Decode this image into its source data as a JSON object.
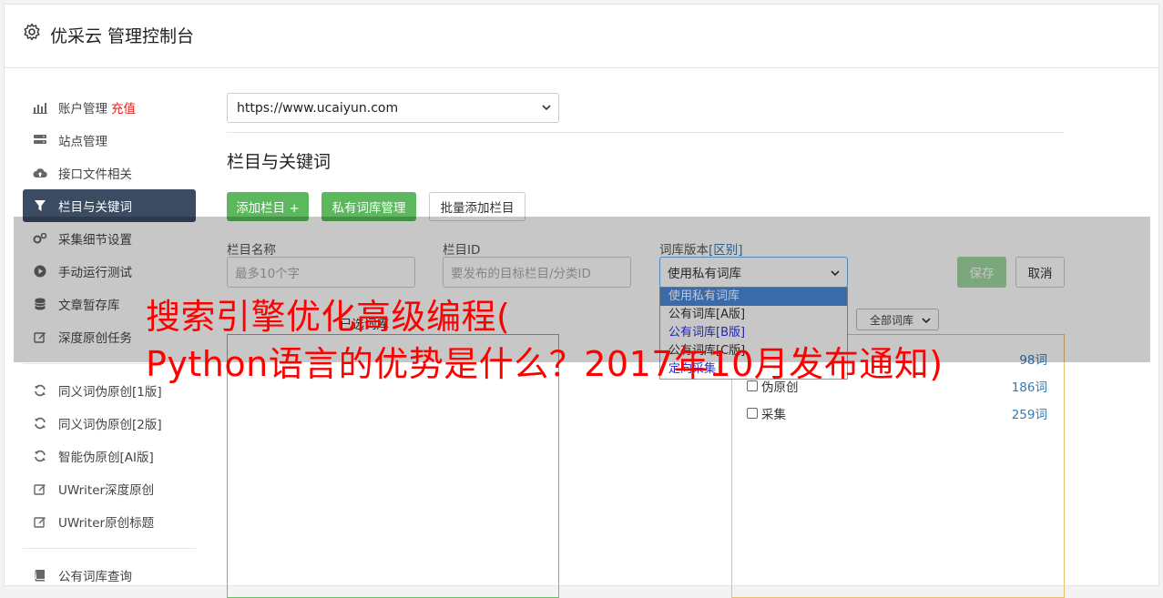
{
  "header": {
    "title": "优采云 管理控制台"
  },
  "sidebar": {
    "items": [
      {
        "label": "账户管理",
        "extra": "充值",
        "icon": "bar-chart-icon"
      },
      {
        "label": "站点管理",
        "icon": "server-icon"
      },
      {
        "label": "接口文件相关",
        "icon": "cloud-upload-icon"
      },
      {
        "label": "栏目与关键词",
        "icon": "filter-icon",
        "active": true
      },
      {
        "label": "采集细节设置",
        "icon": "gears-icon"
      },
      {
        "label": "手动运行测试",
        "icon": "play-circle-icon"
      },
      {
        "label": "文章暂存库",
        "icon": "database-icon"
      },
      {
        "label": "深度原创任务",
        "icon": "edit-icon"
      }
    ],
    "items2": [
      {
        "label": "同义词伪原创[1版]",
        "icon": "refresh-icon"
      },
      {
        "label": "同义词伪原创[2版]",
        "icon": "refresh-icon"
      },
      {
        "label": "智能伪原创[AI版]",
        "icon": "refresh-icon"
      },
      {
        "label": "UWriter深度原创",
        "icon": "edit-icon"
      },
      {
        "label": "UWriter原创标题",
        "icon": "edit-icon"
      }
    ],
    "items3": [
      {
        "label": "公有词库查询",
        "icon": "book-icon"
      }
    ]
  },
  "site_select": {
    "value": "https://www.ucaiyun.com"
  },
  "section": {
    "title": "栏目与关键词"
  },
  "buttons": {
    "add_column": "添加栏目 +",
    "private_lib": "私有词库管理",
    "batch_add": "批量添加栏目",
    "save": "保存",
    "cancel": "取消"
  },
  "form": {
    "name_label": "栏目名称",
    "name_placeholder": "最多10个字",
    "id_label": "栏目ID",
    "id_placeholder": "要发布的目标栏目/分类ID",
    "lib_label": "词库版本",
    "lib_label_link": "[区别]",
    "lib_value": "使用私有词库"
  },
  "dropdown": {
    "options": [
      "使用私有词库",
      "公有词库[A版]",
      "公有词库[B版]",
      "公有词库[C版]",
      "定向采集"
    ]
  },
  "filter_select": {
    "value": "全部词库"
  },
  "left_box": {
    "label": "已选词库"
  },
  "libraries": [
    {
      "name": "",
      "count": "98词"
    },
    {
      "name": "伪原创",
      "count": "186词"
    },
    {
      "name": "采集",
      "count": "259词"
    }
  ],
  "watermark": {
    "line1": "搜索引擎优化高级编程(",
    "line2": "Python语言的优势是什么？2017年10月发布通知)"
  },
  "colors": {
    "primary_green": "#5cb85c",
    "active_nav": "#3b4b62",
    "watermark": "#ff0000"
  }
}
